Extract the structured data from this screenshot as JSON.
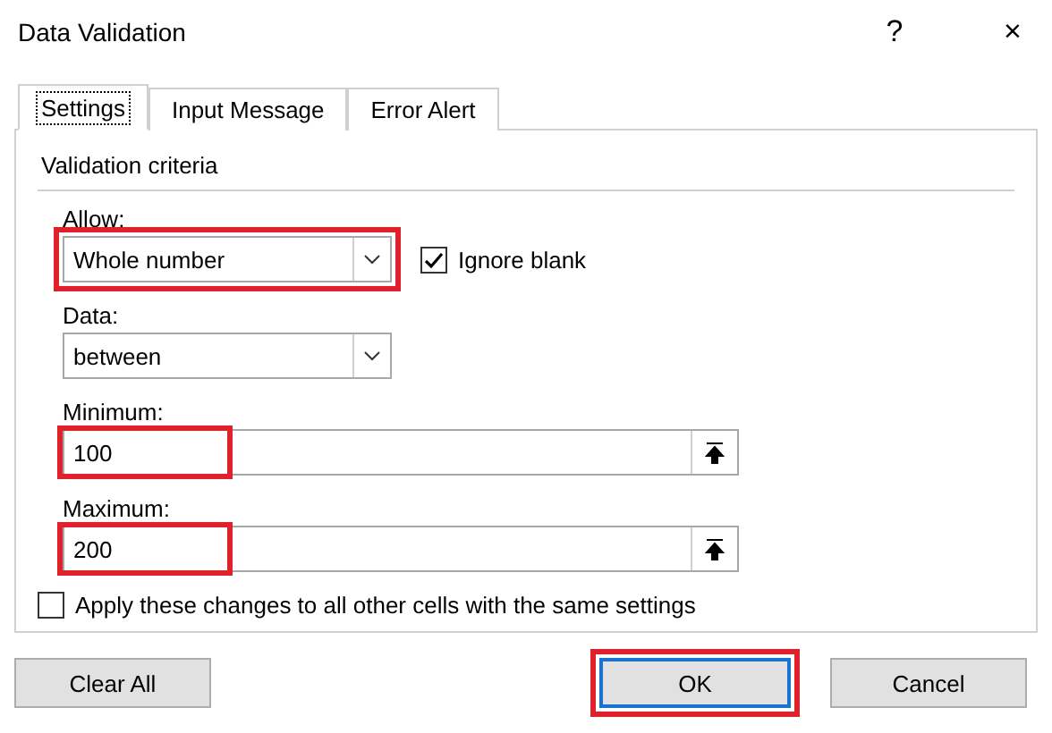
{
  "window": {
    "title": "Data Validation",
    "help": "?",
    "close": "×"
  },
  "tabs": [
    {
      "label": "Settings",
      "selected": true
    },
    {
      "label": "Input Message",
      "selected": false
    },
    {
      "label": "Error Alert",
      "selected": false
    }
  ],
  "group": {
    "title": "Validation criteria"
  },
  "allow": {
    "label": "Allow:",
    "value": "Whole number",
    "highlighted": true
  },
  "ignore_blank": {
    "label": "Ignore blank",
    "checked": true
  },
  "data": {
    "label": "Data:",
    "value": "between"
  },
  "minimum": {
    "label": "Minimum:",
    "value": "100",
    "highlighted": true
  },
  "maximum": {
    "label": "Maximum:",
    "value": "200",
    "highlighted": true
  },
  "apply_all": {
    "label": "Apply these changes to all other cells with the same settings",
    "checked": false
  },
  "buttons": [
    {
      "label": "Clear All",
      "kind": "left"
    },
    {
      "label": "OK",
      "kind": "default",
      "highlighted": true
    },
    {
      "label": "Cancel",
      "kind": "right"
    }
  ]
}
